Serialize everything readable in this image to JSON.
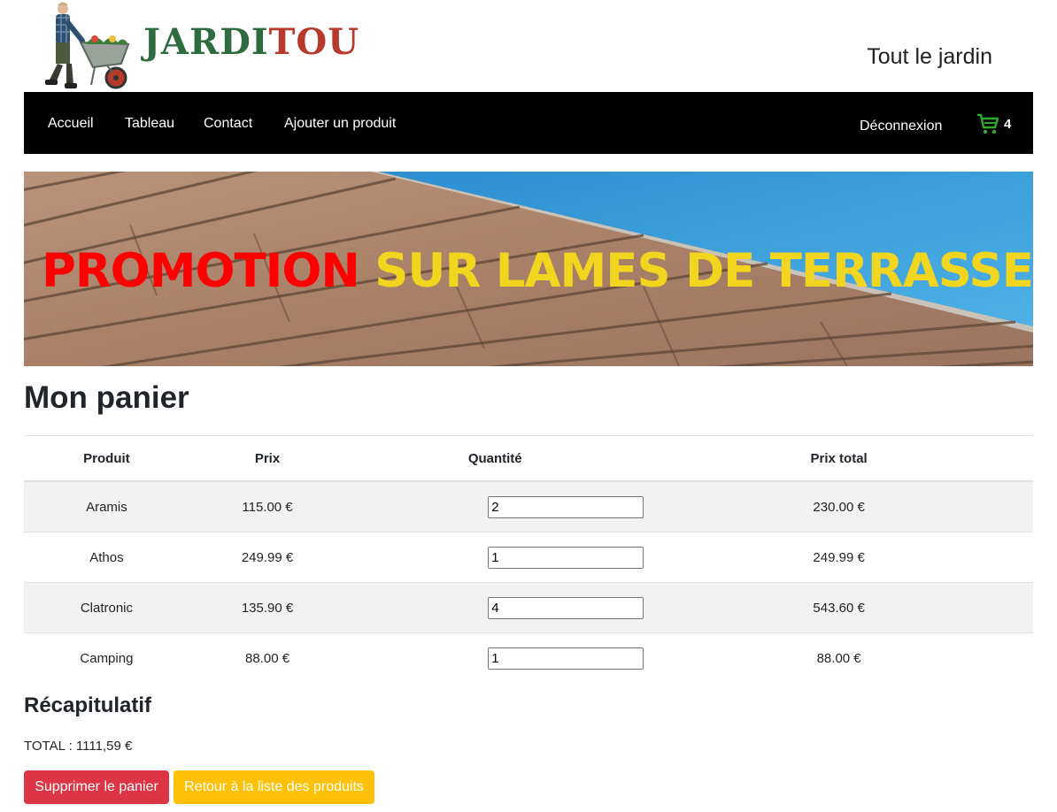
{
  "header": {
    "logo_part1": "JARDI",
    "logo_part2": "TOU",
    "tagline": "Tout le jardin"
  },
  "nav": {
    "items": [
      "Accueil",
      "Tableau",
      "Contact",
      "Ajouter un produit"
    ],
    "logout": "Déconnexion",
    "cart_count": "4"
  },
  "banner": {
    "text_red": "PROMOTION",
    "text_yellow": "SUR LAMES DE TERRASSE"
  },
  "page_title": "Mon panier",
  "table": {
    "headers": [
      "Produit",
      "Prix",
      "Quantité",
      "Prix total"
    ],
    "rows": [
      {
        "product": "Aramis",
        "price": "115.00 €",
        "qty": "2",
        "total": "230.00 €"
      },
      {
        "product": "Athos",
        "price": "249.99 €",
        "qty": "1",
        "total": "249.99 €"
      },
      {
        "product": "Clatronic",
        "price": "135.90 €",
        "qty": "4",
        "total": "543.60 €"
      },
      {
        "product": "Camping",
        "price": "88.00 €",
        "qty": "1",
        "total": "88.00 €"
      }
    ]
  },
  "summary": {
    "title": "Récapitulatif",
    "total": "TOTAL : 1111,59 €"
  },
  "buttons": {
    "clear_cart": "Supprimer le panier",
    "back_to_list": "Retour à la liste des produits"
  },
  "colors": {
    "navbar": "#000000",
    "danger": "#dc3545",
    "warning": "#ffc107",
    "logo_green": "#2e6b3f",
    "logo_red": "#b8382b"
  }
}
